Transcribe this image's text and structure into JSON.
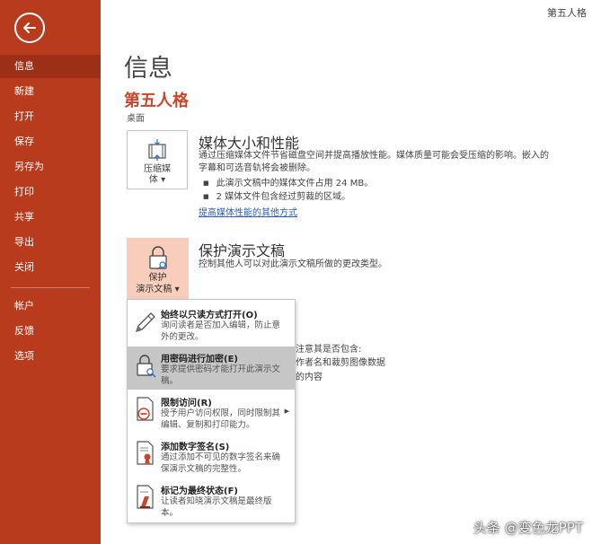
{
  "window_title": "第五人格",
  "sidebar": {
    "items": [
      {
        "label": "信息"
      },
      {
        "label": "新建"
      },
      {
        "label": "打开"
      },
      {
        "label": "保存"
      },
      {
        "label": "另存为"
      },
      {
        "label": "打印"
      },
      {
        "label": "共享"
      },
      {
        "label": "导出"
      },
      {
        "label": "关闭"
      },
      {
        "label": "帐户"
      },
      {
        "label": "反馈"
      },
      {
        "label": "选项"
      }
    ]
  },
  "main": {
    "page_title": "信息",
    "doc_name": "第五人格",
    "doc_location": "桌面",
    "media": {
      "button_label_1": "压缩媒",
      "button_label_2": "体 ▾",
      "heading": "媒体大小和性能",
      "description_1": "通过压缩媒体文件节省磁盘空间并提高播放性能。媒体质量可能会受压缩的影响。嵌入的",
      "description_2": "字幕和可选音轨将会被删除。",
      "bullets": [
        "此演示文稿中的媒体文件占用 24 MB。",
        "2 媒体文件包含经过剪裁的区域。"
      ],
      "link": "提高媒体性能的其他方式"
    },
    "protect": {
      "button_label_1": "保护",
      "button_label_2": "演示文稿 ▾",
      "heading": "保护演示文稿",
      "description": "控制其他人可以对此演示文稿所做的更改类型。"
    },
    "partial_text": {
      "line1": "注意其是否包含:",
      "line2": "作者名和裁剪图像数据",
      "line3": "的内容"
    }
  },
  "protect_menu": {
    "items": [
      {
        "title": "始终以只读方式打开(O)",
        "desc": "询问读者是否加入编辑，防止意外的更改。"
      },
      {
        "title": "用密码进行加密(E)",
        "desc": "要求提供密码才能打开此演示文稿。"
      },
      {
        "title": "限制访问(R)",
        "desc": "授予用户访问权限，同时限制其编辑、复制和打印能力。"
      },
      {
        "title": "添加数字签名(S)",
        "desc": "通过添加不可见的数字签名来确保演示文稿的完整性。"
      },
      {
        "title": "标记为最终状态(F)",
        "desc": "让读者知晓演示文稿是最终版本。"
      }
    ]
  },
  "watermark": "头条 @变色龙PPT",
  "colors": {
    "sidebar_bg": "#b83b1e",
    "sidebar_active": "#9d2f17",
    "accent_red": "#c8482d",
    "protect_tile": "#f9cdbb",
    "menu_highlight": "#c6c6c6",
    "link_blue": "#2a5db0"
  }
}
